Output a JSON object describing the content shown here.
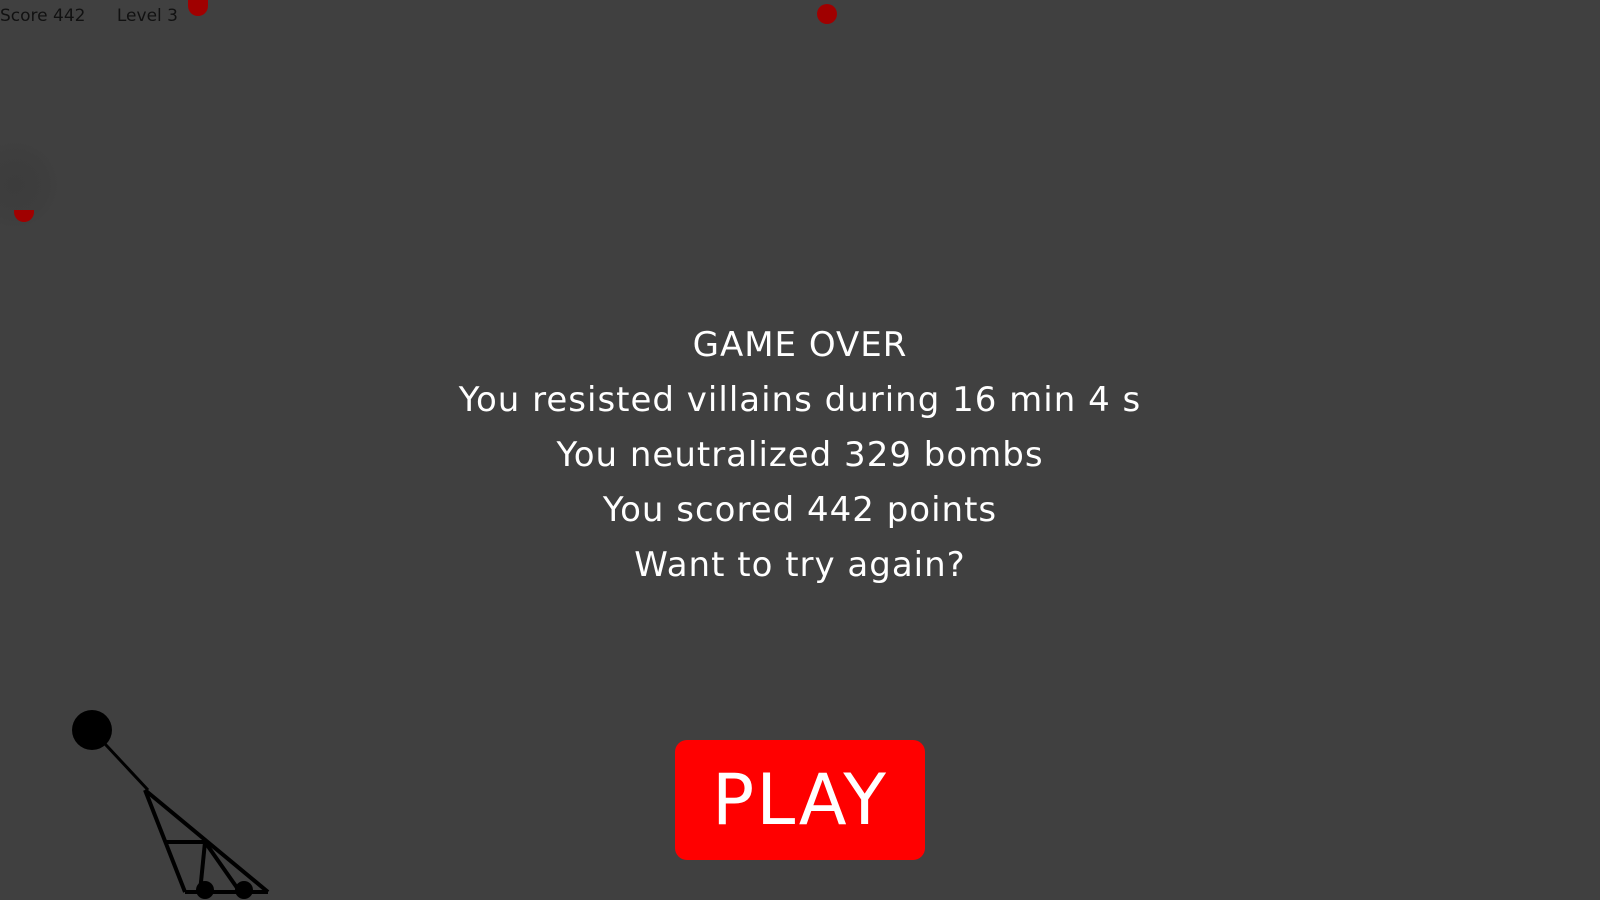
{
  "hud": {
    "score_text": "Score 442",
    "level_text": "Level 3"
  },
  "game_over": {
    "title": "GAME OVER",
    "time_line": "You resisted villains during 16 min 4 s",
    "bombs_line": "You neutralized 329 bombs",
    "points_line": "You scored 442 points",
    "retry_line": "Want to try again?"
  },
  "play_button": {
    "label": "PLAY"
  },
  "colors": {
    "background": "#404040",
    "bomb": "#a00000",
    "play_button": "#ff0000",
    "text": "#ffffff"
  }
}
